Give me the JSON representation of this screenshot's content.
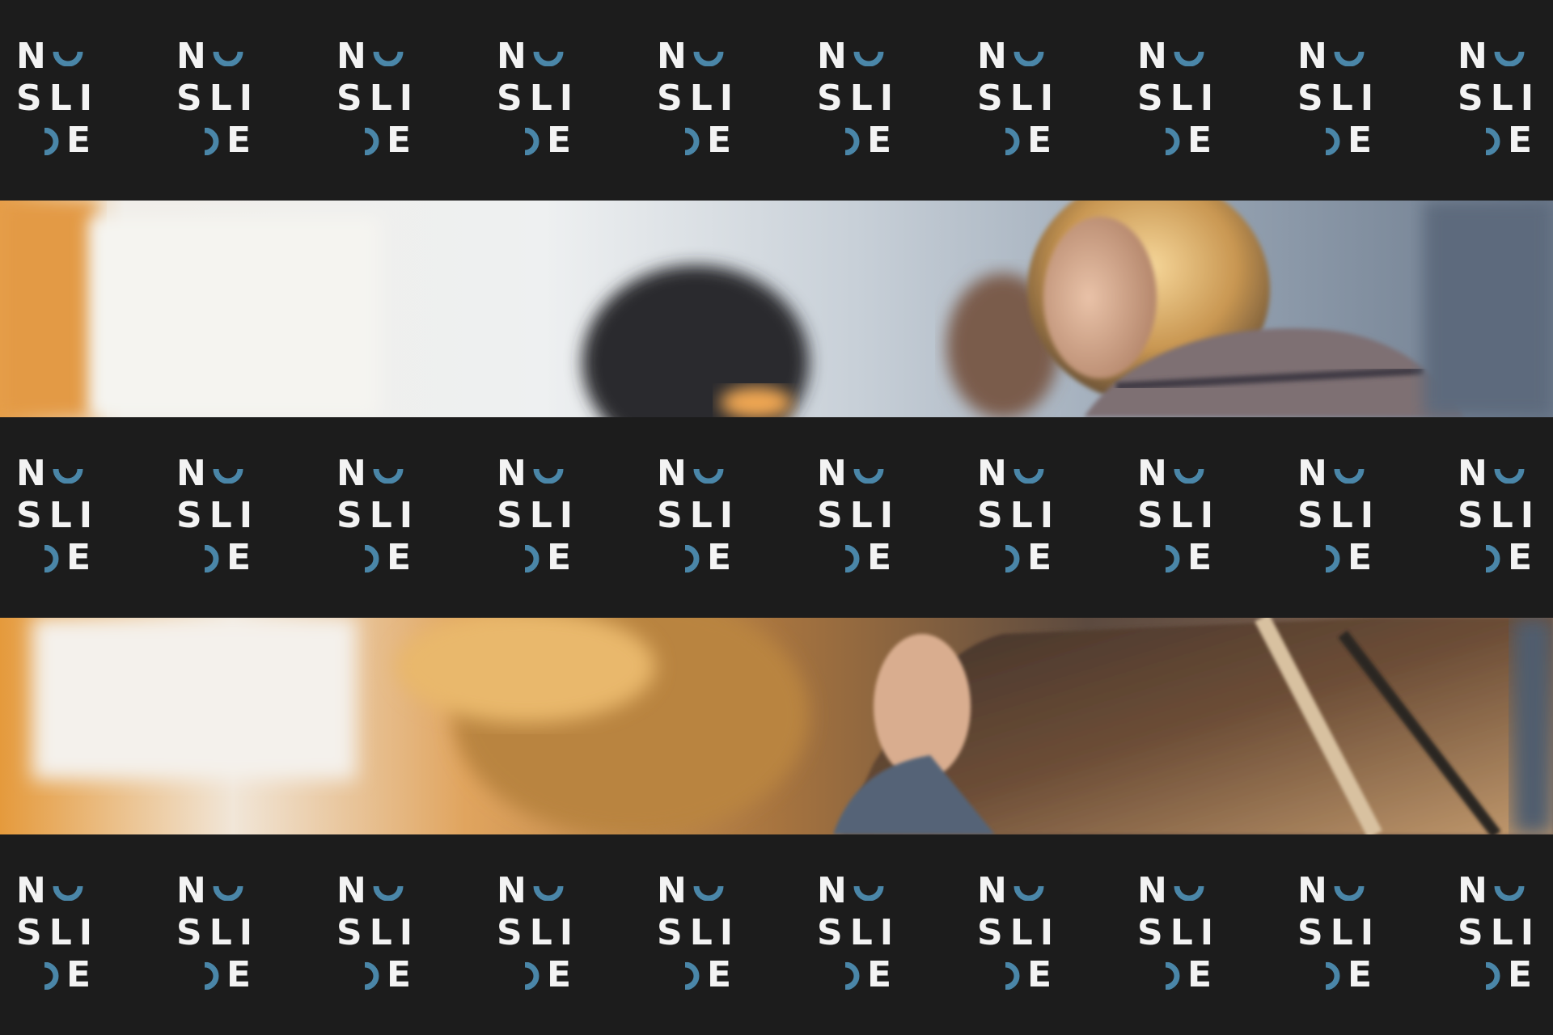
{
  "logo": {
    "line1": "N",
    "line2": "SLI",
    "line3": "E"
  },
  "colors": {
    "background": "#1c1c1c",
    "letters": "#f3f3f3",
    "accent": "#4a86a8"
  },
  "icons": {
    "smile": "smile-arc-icon",
    "moon": "crescent-icon"
  }
}
